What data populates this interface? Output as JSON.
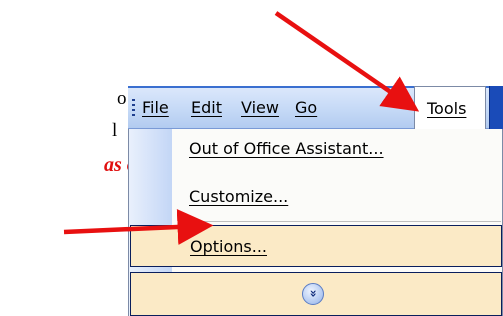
{
  "document_text": {
    "line1": "o",
    "line2": "l",
    "line3": "as of"
  },
  "menubar": {
    "items": [
      "File",
      "Edit",
      "View",
      "Go",
      "Tools"
    ],
    "active": "Tools"
  },
  "tools_menu": {
    "out_of_office": "Out of Office Assistant...",
    "customize": "Customize...",
    "options": "Options...",
    "expand_glyph": "»",
    "highlighted": "Options..."
  },
  "colors": {
    "arrow": "#e81010",
    "menubar": "#c5d9f6",
    "highlight": "#fbeac6"
  },
  "annotations": {
    "arrow1_target": "Tools",
    "arrow2_target": "Options..."
  }
}
